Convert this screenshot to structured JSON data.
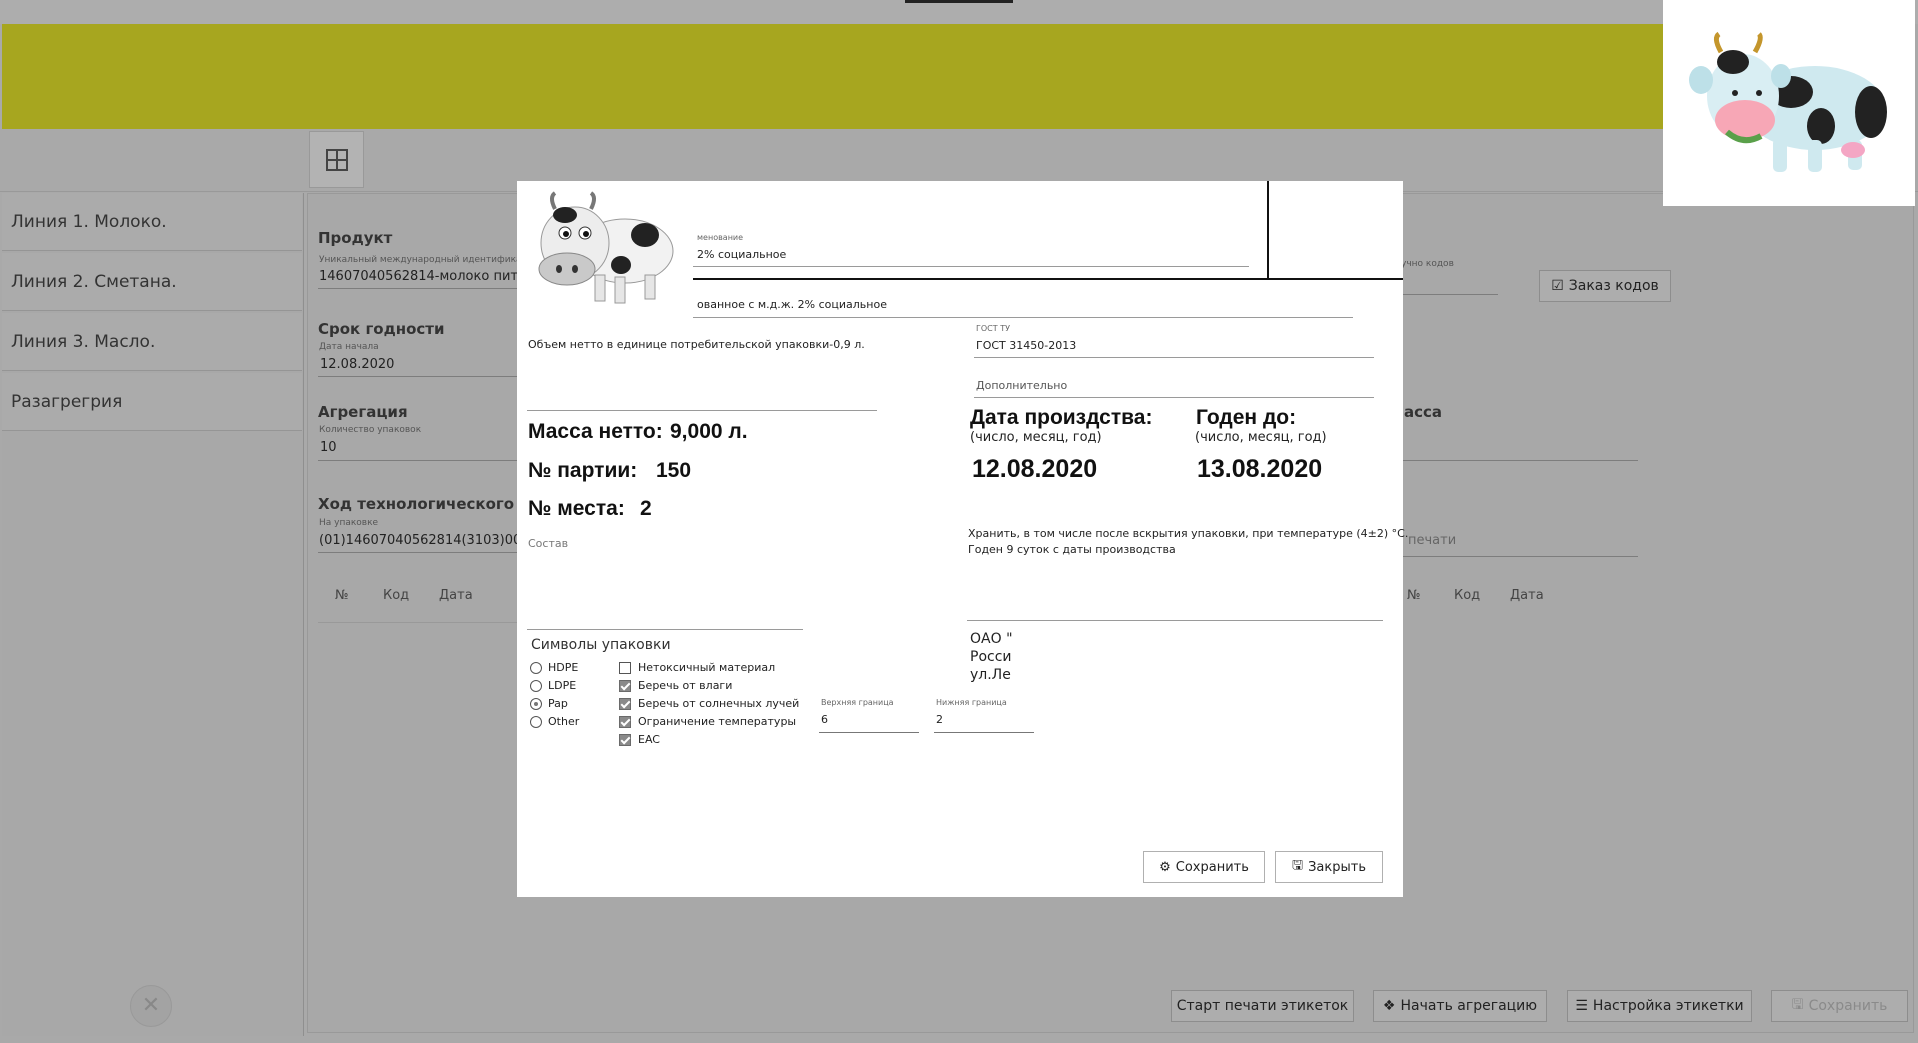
{
  "sidebar": {
    "items": [
      {
        "label": "Линия 1. Молоко."
      },
      {
        "label": "Линия 2. Сметана."
      },
      {
        "label": "Линия 3. Масло."
      },
      {
        "label": "Разагрегрия"
      }
    ]
  },
  "main": {
    "product_heading": "Продукт",
    "gtin_label": "Уникальный международный идентифика",
    "gtin_value": "14607040562814-молоко пите",
    "shelf_heading": "Срок годности",
    "start_label": "Дата начала",
    "start_value": "12.08.2020",
    "agg_heading": "Агрегация",
    "count_label": "Количество упаковок",
    "count_value": "10",
    "process_heading": "Ход технологического про",
    "pack_label": "На упаковке",
    "pack_value": "(01)14607040562814(3103)0090",
    "table_left": {
      "headers": [
        "№",
        "Код",
        "Дата"
      ]
    },
    "table_right": {
      "headers": [
        "№",
        "Код",
        "Дата"
      ]
    },
    "codes_label": "учно кодов",
    "order_button": "Заказ кодов",
    "mass_heading": "асса",
    "print_label": "печати"
  },
  "bottom": {
    "start_print": "Старт печати этикеток",
    "start_agg": "Начать агрегацию",
    "label_settings": "Настройка этикетки",
    "save": "Сохранить"
  },
  "dialog": {
    "name_label": "менование",
    "name_value": "2% социальное",
    "full_name": "ованное с м.д.ж. 2% социальное",
    "volume_text": "Объем нетто в единице потребительской упаковки-0,9 л.",
    "gost_label": "ГОСТ ТУ",
    "gost_value": "ГОСТ 31450-2013",
    "extra_label": "Дополнительно",
    "mass_label": "Масса нетто:",
    "mass_value": "9,000 л.",
    "batch_label": "№ партии:",
    "batch_value": "150",
    "place_label": "№ места:",
    "place_value": "2",
    "composition_label": "Состав",
    "prod_date_title": "Дата произдства:",
    "prod_date_sub": "(число, месяц, год)",
    "prod_date_value": "12.08.2020",
    "expiry_title": "Годен до:",
    "expiry_sub": "(число, месяц, год)",
    "expiry_value": "13.08.2020",
    "storage_line1": "Хранить, в том числе после вскрытия упаковки, при температуре (4±2) °С.",
    "storage_line2": "Годен 9 суток с даты производства",
    "address_lines": [
      "ОАО \"",
      "Росси",
      "ул.Ле"
    ],
    "symbols_title": "Символы упаковки",
    "radios": [
      {
        "label": "HDPE",
        "checked": false
      },
      {
        "label": "LDPE",
        "checked": false
      },
      {
        "label": "Pap",
        "checked": true
      },
      {
        "label": "Other",
        "checked": false
      }
    ],
    "checks": [
      {
        "label": "Нетоксичный материал",
        "checked": false
      },
      {
        "label": "Беречь от влаги",
        "checked": true
      },
      {
        "label": "Беречь от солнечных лучей",
        "checked": true
      },
      {
        "label": "Ограничение температуры",
        "checked": true
      },
      {
        "label": "EAC",
        "checked": true
      }
    ],
    "upper_label": "Верхняя граница",
    "upper_value": "6",
    "lower_label": "Нижняя граница",
    "lower_value": "2",
    "save_button": "Сохранить",
    "close_button": "Закрыть"
  },
  "icons": [
    "grid-icon",
    "close-icon",
    "check-square-icon",
    "gear-icon",
    "floppy-icon",
    "dropbox-icon",
    "list-icon",
    "cow-logo",
    "cow-image"
  ]
}
